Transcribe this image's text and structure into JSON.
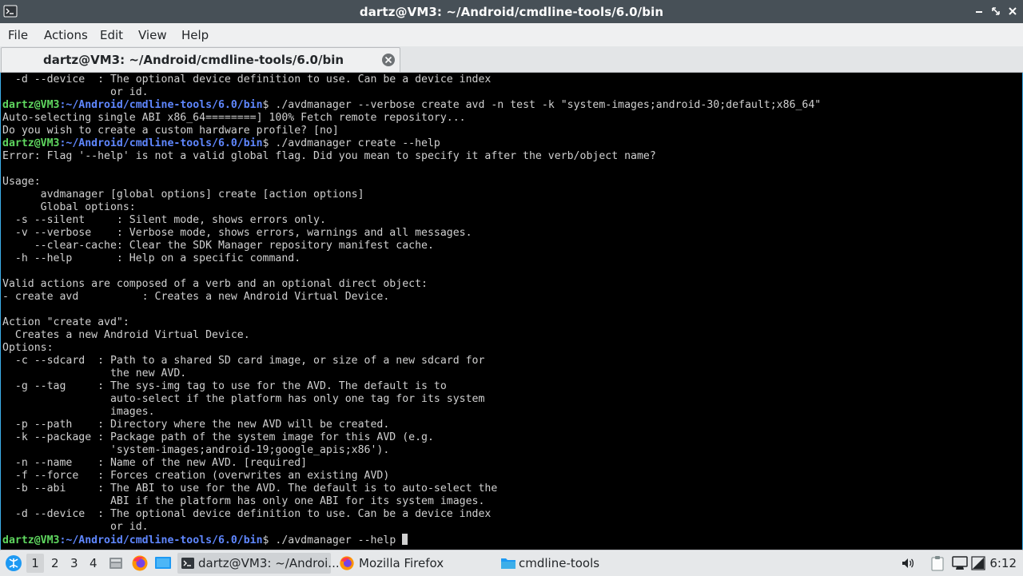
{
  "window": {
    "title": "dartz@VM3: ~/Android/cmdline-tools/6.0/bin"
  },
  "menu": {
    "items": [
      "File",
      "Actions",
      "Edit",
      "View",
      "Help"
    ]
  },
  "tabs": [
    {
      "label": "dartz@VM3: ~/Android/cmdline-tools/6.0/bin",
      "active": true
    }
  ],
  "terminal": {
    "prompt_user": "dartz@VM3",
    "prompt_path": ":~/Android/cmdline-tools/6.0/bin",
    "lines": [
      {
        "text": "  -d --device  : The optional device definition to use. Can be a device index"
      },
      {
        "text": "                 or id."
      },
      {
        "prompt": true,
        "cmd": "$ ./avdmanager --verbose create avd -n test -k \"system-images;android-30;default;x86_64\""
      },
      {
        "text": "Auto-selecting single ABI x86_64========] 100% Fetch remote repository..."
      },
      {
        "text": "Do you wish to create a custom hardware profile? [no]"
      },
      {
        "prompt": true,
        "cmd": "$ ./avdmanager create --help"
      },
      {
        "text": "Error: Flag '--help' is not a valid global flag. Did you mean to specify it after the verb/object name?"
      },
      {
        "text": ""
      },
      {
        "text": "Usage:"
      },
      {
        "text": "      avdmanager [global options] create [action options]"
      },
      {
        "text": "      Global options:"
      },
      {
        "text": "  -s --silent     : Silent mode, shows errors only."
      },
      {
        "text": "  -v --verbose    : Verbose mode, shows errors, warnings and all messages."
      },
      {
        "text": "     --clear-cache: Clear the SDK Manager repository manifest cache."
      },
      {
        "text": "  -h --help       : Help on a specific command."
      },
      {
        "text": ""
      },
      {
        "text": "Valid actions are composed of a verb and an optional direct object:"
      },
      {
        "text": "- create avd          : Creates a new Android Virtual Device."
      },
      {
        "text": ""
      },
      {
        "text": "Action \"create avd\":"
      },
      {
        "text": "  Creates a new Android Virtual Device."
      },
      {
        "text": "Options:"
      },
      {
        "text": "  -c --sdcard  : Path to a shared SD card image, or size of a new sdcard for"
      },
      {
        "text": "                 the new AVD."
      },
      {
        "text": "  -g --tag     : The sys-img tag to use for the AVD. The default is to"
      },
      {
        "text": "                 auto-select if the platform has only one tag for its system"
      },
      {
        "text": "                 images."
      },
      {
        "text": "  -p --path    : Directory where the new AVD will be created."
      },
      {
        "text": "  -k --package : Package path of the system image for this AVD (e.g."
      },
      {
        "text": "                 'system-images;android-19;google_apis;x86')."
      },
      {
        "text": "  -n --name    : Name of the new AVD. [required]"
      },
      {
        "text": "  -f --force   : Forces creation (overwrites an existing AVD)"
      },
      {
        "text": "  -b --abi     : The ABI to use for the AVD. The default is to auto-select the"
      },
      {
        "text": "                 ABI if the platform has only one ABI for its system images."
      },
      {
        "text": "  -d --device  : The optional device definition to use. Can be a device index"
      },
      {
        "text": "                 or id."
      },
      {
        "prompt": true,
        "cmd": "$ ./avdmanager --help ",
        "cursor": true
      }
    ]
  },
  "taskbar": {
    "workspaces": [
      "1",
      "2",
      "3",
      "4"
    ],
    "tasks": [
      {
        "label": "dartz@VM3: ~/Androi...",
        "icon": "terminal-icon",
        "active": true
      },
      {
        "label": "Mozilla Firefox",
        "icon": "firefox-icon",
        "active": false
      },
      {
        "label": "cmdline-tools",
        "icon": "folder-icon",
        "active": false
      }
    ],
    "clock": "6:12"
  },
  "colors": {
    "titlebar": "#475057",
    "terminal_bg": "#000000",
    "terminal_fg": "#d0d0d0",
    "prompt_user": "#5fd75f",
    "prompt_path": "#5f87ff",
    "focus_border": "#3daee9"
  }
}
